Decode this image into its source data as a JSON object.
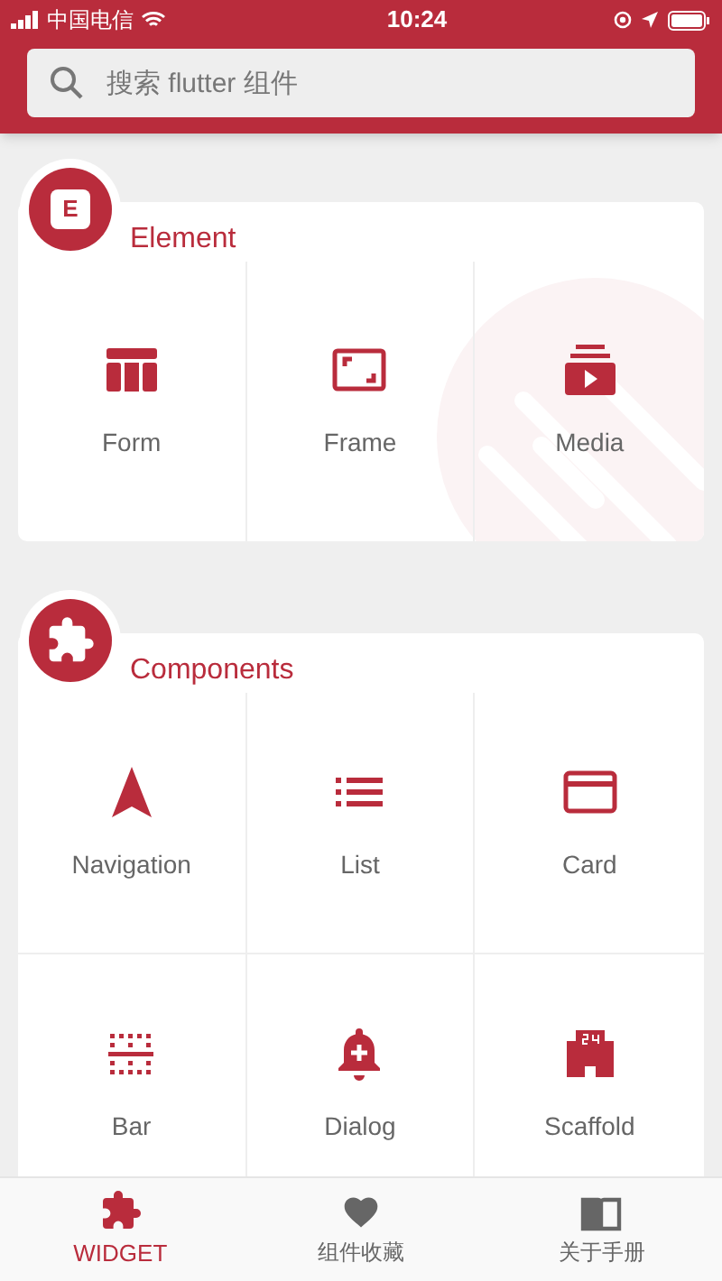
{
  "status_bar": {
    "carrier": "中国电信",
    "time": "10:24"
  },
  "search": {
    "placeholder": "搜索 flutter 组件"
  },
  "sections": [
    {
      "title": "Element",
      "badge": "E",
      "items": [
        {
          "label": "Form"
        },
        {
          "label": "Frame"
        },
        {
          "label": "Media"
        }
      ]
    },
    {
      "title": "Components",
      "items": [
        {
          "label": "Navigation"
        },
        {
          "label": "List"
        },
        {
          "label": "Card"
        },
        {
          "label": "Bar"
        },
        {
          "label": "Dialog"
        },
        {
          "label": "Scaffold"
        }
      ]
    }
  ],
  "bottom_nav": [
    {
      "label": "WIDGET",
      "selected": true
    },
    {
      "label": "组件收藏",
      "selected": false
    },
    {
      "label": "关于手册",
      "selected": false
    }
  ]
}
